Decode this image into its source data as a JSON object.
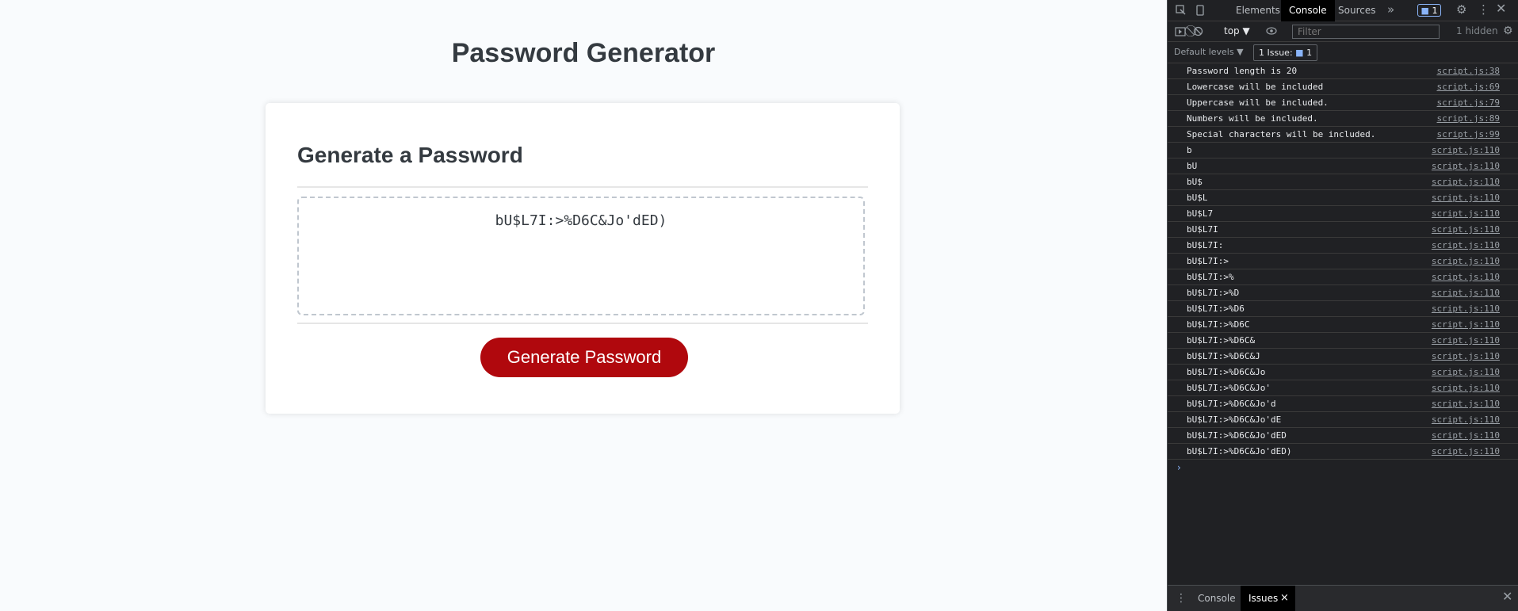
{
  "page": {
    "title": "Password Generator",
    "card_title": "Generate a Password",
    "password": "bU$L7I:>%D6C&Jo'dED)",
    "button_label": "Generate Password",
    "accent": "#b0080d"
  },
  "devtools": {
    "tabs": [
      "Elements",
      "Console",
      "Sources"
    ],
    "active_tab": "Console",
    "more_tabs": "»",
    "message_count": "1",
    "context": "top ▼",
    "filter_placeholder": "Filter",
    "hidden_count": "1 hidden",
    "default_levels": "Default levels ▼",
    "issues_label": "1 Issue:",
    "issues_count": "1",
    "log": [
      {
        "msg": "Password length is 20",
        "src": "script.js:38"
      },
      {
        "msg": "Lowercase will be included",
        "src": "script.js:69"
      },
      {
        "msg": "Uppercase will be included.",
        "src": "script.js:79"
      },
      {
        "msg": "Numbers will be included.",
        "src": "script.js:89"
      },
      {
        "msg": "Special characters will be included.",
        "src": "script.js:99"
      },
      {
        "msg": "b",
        "src": "script.js:110"
      },
      {
        "msg": "bU",
        "src": "script.js:110"
      },
      {
        "msg": "bU$",
        "src": "script.js:110"
      },
      {
        "msg": "bU$L",
        "src": "script.js:110"
      },
      {
        "msg": "bU$L7",
        "src": "script.js:110"
      },
      {
        "msg": "bU$L7I",
        "src": "script.js:110"
      },
      {
        "msg": "bU$L7I:",
        "src": "script.js:110"
      },
      {
        "msg": "bU$L7I:>",
        "src": "script.js:110"
      },
      {
        "msg": "bU$L7I:>%",
        "src": "script.js:110"
      },
      {
        "msg": "bU$L7I:>%D",
        "src": "script.js:110"
      },
      {
        "msg": "bU$L7I:>%D6",
        "src": "script.js:110"
      },
      {
        "msg": "bU$L7I:>%D6C",
        "src": "script.js:110"
      },
      {
        "msg": "bU$L7I:>%D6C&",
        "src": "script.js:110"
      },
      {
        "msg": "bU$L7I:>%D6C&J",
        "src": "script.js:110"
      },
      {
        "msg": "bU$L7I:>%D6C&Jo",
        "src": "script.js:110"
      },
      {
        "msg": "bU$L7I:>%D6C&Jo'",
        "src": "script.js:110"
      },
      {
        "msg": "bU$L7I:>%D6C&Jo'd",
        "src": "script.js:110"
      },
      {
        "msg": "bU$L7I:>%D6C&Jo'dE",
        "src": "script.js:110"
      },
      {
        "msg": "bU$L7I:>%D6C&Jo'dED",
        "src": "script.js:110"
      },
      {
        "msg": "bU$L7I:>%D6C&Jo'dED)",
        "src": "script.js:110"
      }
    ],
    "prompt": "›",
    "drawer_tabs": [
      "Console",
      "Issues"
    ],
    "drawer_active": "Issues",
    "drawer_close": "×"
  }
}
